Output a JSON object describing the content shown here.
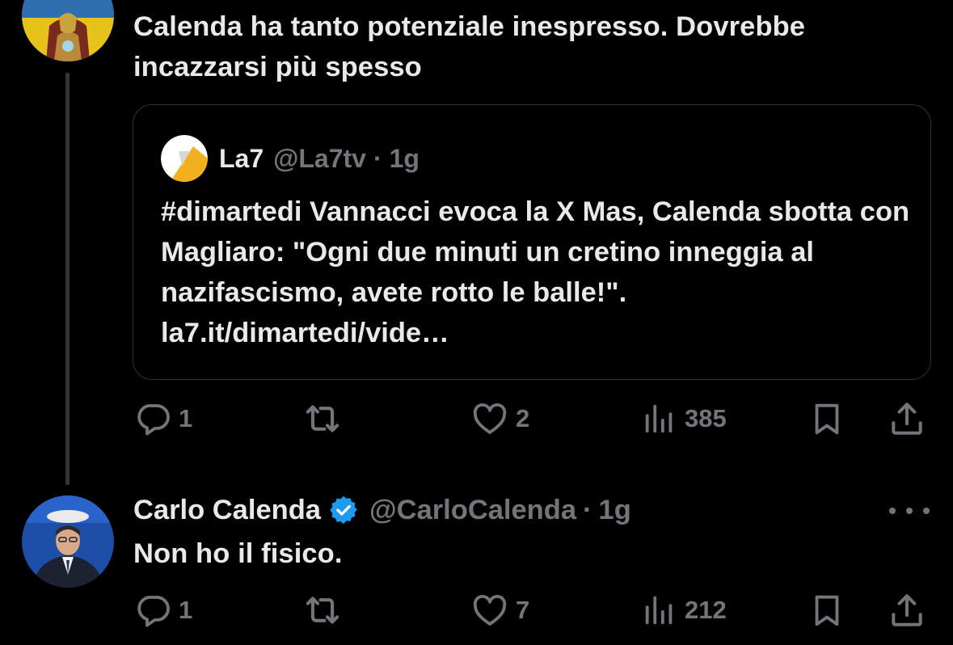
{
  "tweet1": {
    "text": "Calenda ha tanto potenziale inespresso. Dovrebbe incazzarsi più spesso",
    "quote": {
      "name": "La7",
      "handle": "@La7tv",
      "separator": "·",
      "time": "1g",
      "text": "#dimartedi Vannacci evoca la X Mas, Calenda sbotta con Magliaro: \"Ogni due minuti un cretino inneggia al nazifascismo, avete rotto le balle!\". la7.it/dimartedi/vide…"
    },
    "actions": {
      "replies": "1",
      "retweets": "",
      "likes": "2",
      "views": "385"
    }
  },
  "tweet2": {
    "author_name": "Carlo Calenda",
    "handle": "@CarloCalenda",
    "separator": "·",
    "time": "1g",
    "text": "Non ho il fisico.",
    "actions": {
      "replies": "1",
      "retweets": "",
      "likes": "7",
      "views": "212"
    }
  },
  "colors": {
    "background": "#000000",
    "text": "#e7e9ea",
    "muted": "#71767b",
    "border": "#2f3336",
    "verified": "#1d9bf0"
  },
  "icons": [
    "reply-icon",
    "retweet-icon",
    "like-icon",
    "views-icon",
    "bookmark-icon",
    "share-icon",
    "verified-badge-icon",
    "more-icon"
  ]
}
